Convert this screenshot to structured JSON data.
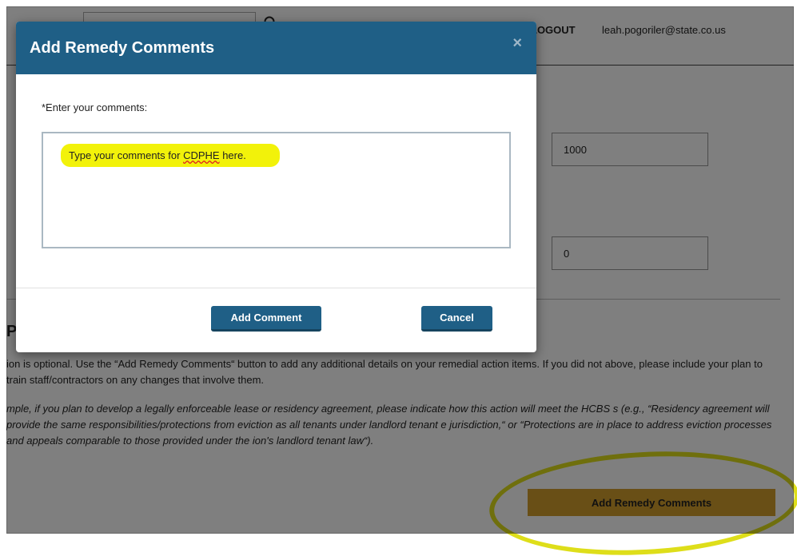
{
  "header": {
    "logout_label": "LOGOUT",
    "user_email": "leah.pogoriler@state.co.us"
  },
  "form": {
    "field1_value": "1000",
    "field2_value": "0"
  },
  "section": {
    "heading": "Pl",
    "description": "ion is optional. Use the “Add Remedy Comments“ button to add any additional details on your remedial action items. If you did not above, please include your plan to train staff/contractors on any changes that involve them.",
    "example": "mple, if you plan to develop a legally enforceable lease or residency agreement, please indicate how this action will meet the HCBS s (e.g., “Residency agreement will provide the same responsibilities/protections from eviction as all tenants under landlord tenant e jurisdiction,“ or “Protections are in place to address eviction processes and appeals comparable to those provided under the ion's landlord tenant law“).",
    "remedy_button": "Add Remedy Comments"
  },
  "modal": {
    "title": "Add Remedy Comments",
    "close_symbol": "×",
    "comments_label": "*Enter your comments:",
    "typed_prefix": "Type your comments for ",
    "typed_misspelled": "CDPHE",
    "typed_suffix": " here.",
    "add_button": "Add Comment",
    "cancel_button": "Cancel"
  },
  "colors": {
    "modal_header": "#1f5f86",
    "highlight": "#f2f20a",
    "remedy_button": "#d39e2c"
  },
  "icons": {
    "search": "search-icon",
    "close": "close-icon"
  }
}
